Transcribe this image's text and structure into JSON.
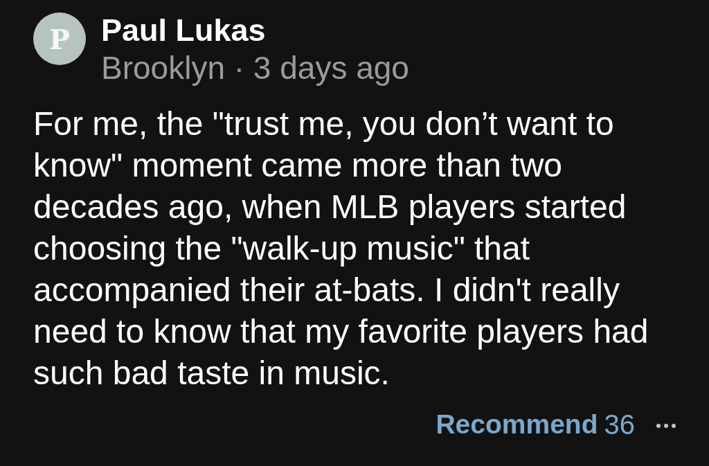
{
  "comment": {
    "avatar": {
      "letter": "P"
    },
    "author": "Paul Lukas",
    "byline": "Brooklyn · 3 days ago",
    "body": "For me, the \"trust me, you don’t want to know\" moment came more than two decades ago, when MLB players started choosing the \"walk-up music\" that accompanied their at-bats. I didn't really need to know that my favorite players had such bad taste in music.",
    "recommend": {
      "label": "Recommend",
      "count": "36"
    }
  }
}
